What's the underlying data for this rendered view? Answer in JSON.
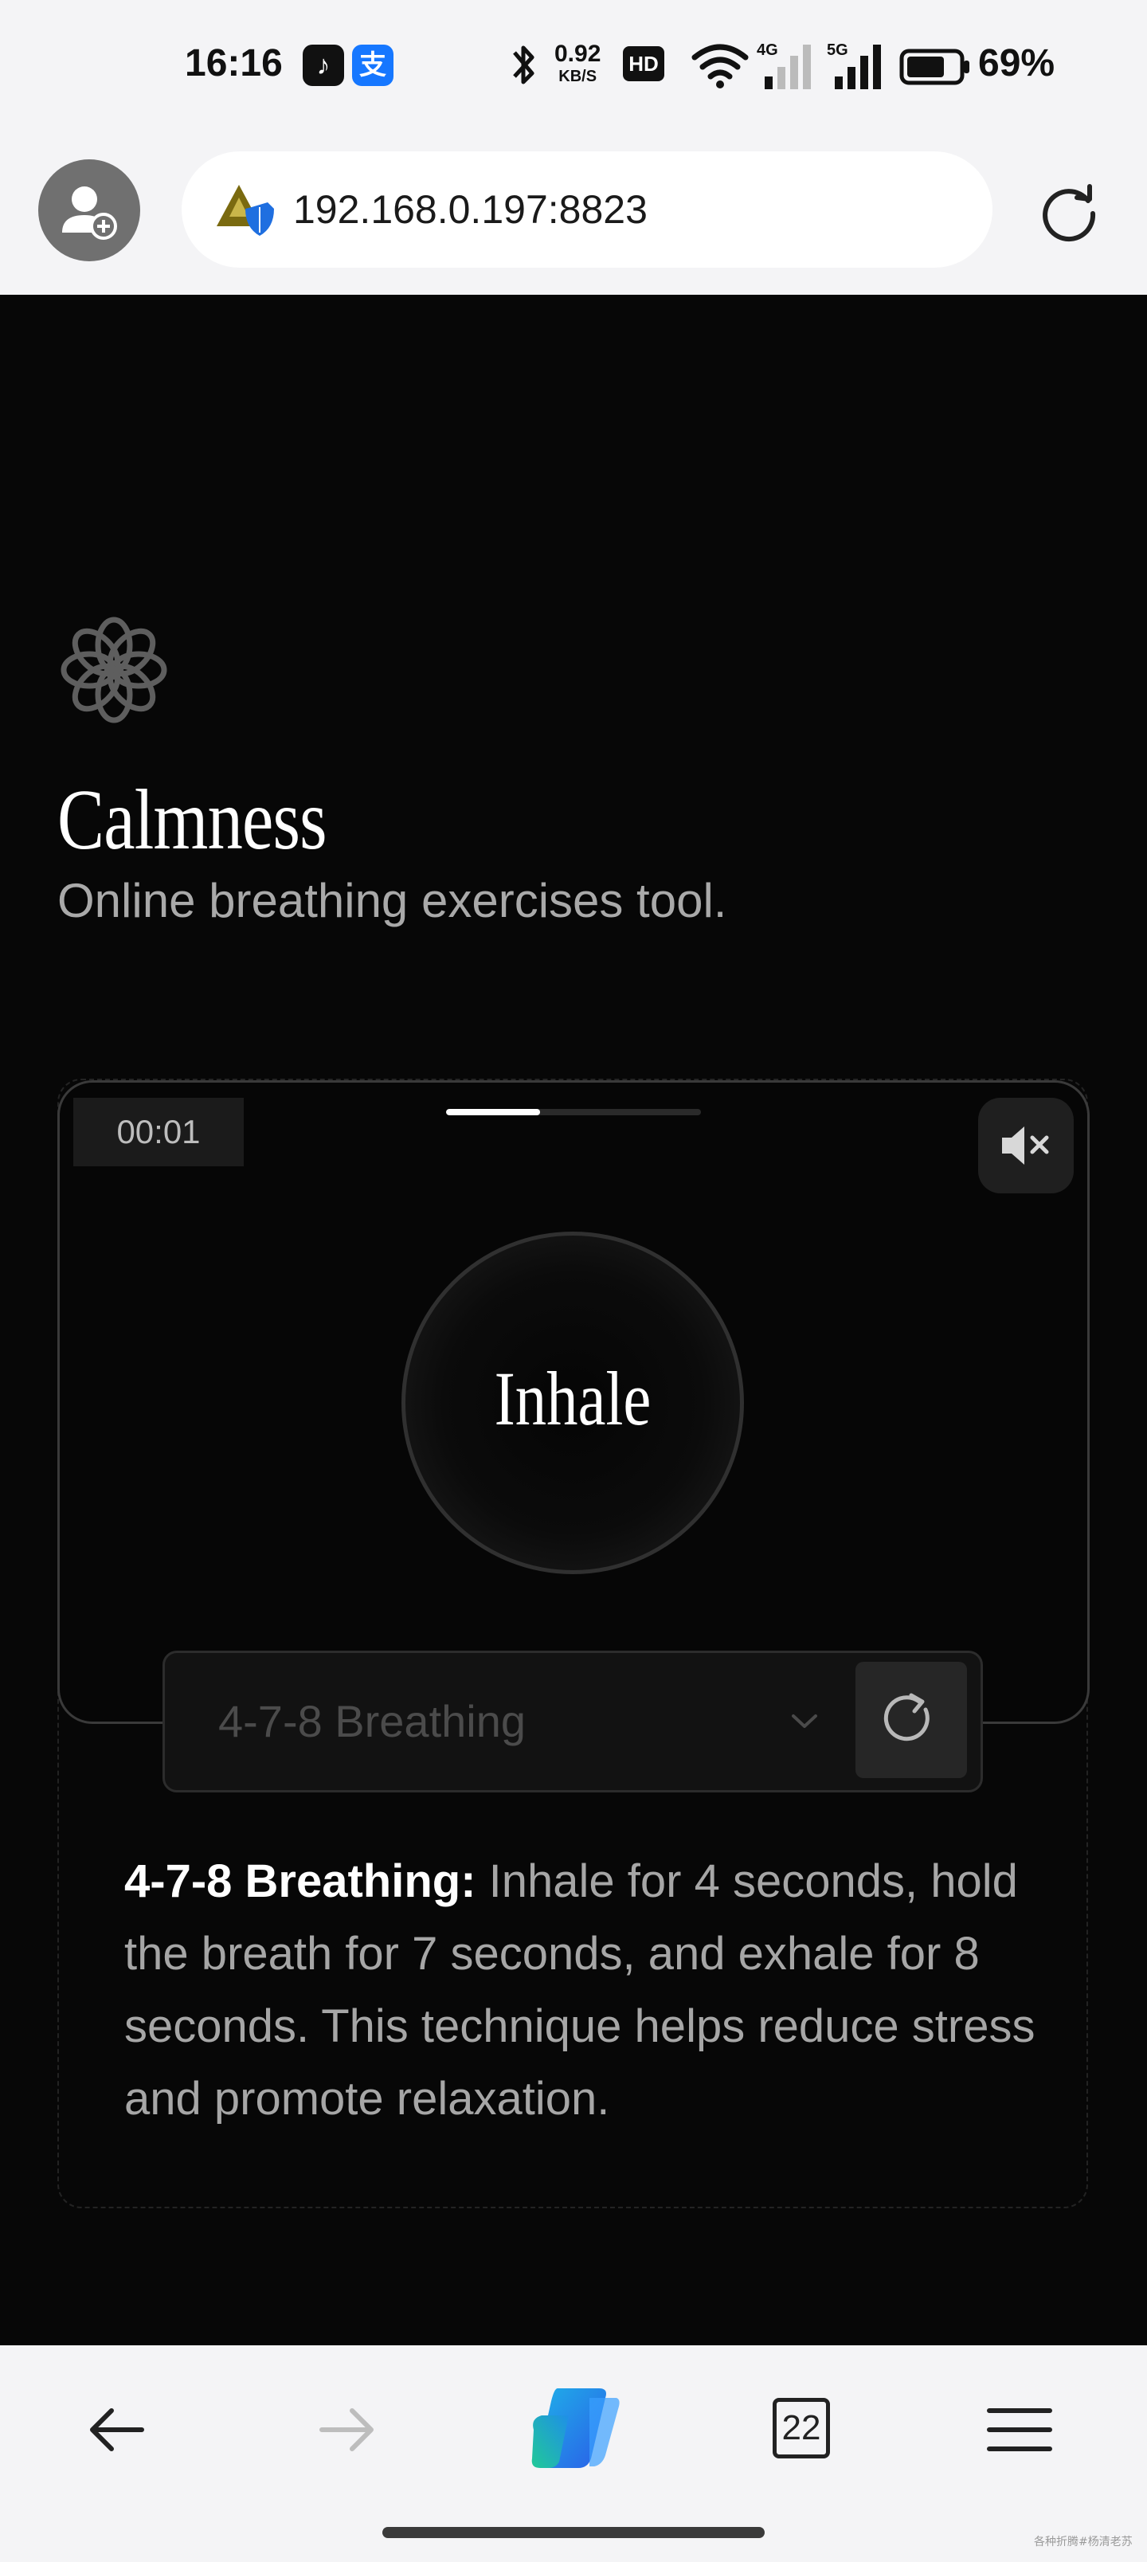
{
  "status_bar": {
    "time": "16:16",
    "apps": [
      {
        "icon": "tiktok-icon",
        "glyph": "♪"
      },
      {
        "icon": "alipay-icon",
        "glyph": "支"
      }
    ],
    "net_speed": "0.92",
    "net_unit": "KB/S",
    "hd_badge": "HD",
    "sim_labels": [
      "4G",
      "5G"
    ],
    "battery": "69%"
  },
  "browser": {
    "url": "192.168.0.197:8823",
    "tab_count": "22"
  },
  "app": {
    "title": "Calmness",
    "subtitle": "Online breathing exercises tool.",
    "timer": "00:01",
    "progress_fraction": 0.37,
    "phase": "Inhale",
    "technique": "4-7-8 Breathing",
    "description_title": "4-7-8 Breathing:",
    "description_body": "Inhale for 4 seconds, hold the breath for 7 seconds, and exhale for 8 seconds. This technique helps reduce stress and promote relaxation."
  },
  "watermark": "各种折腾#杨清老苏",
  "colors": {
    "page_bg": "#070707",
    "browser_chrome": "#f4f4f6",
    "card_border": "#3a3a3a",
    "copilot_accent": "#1fb0e8"
  }
}
